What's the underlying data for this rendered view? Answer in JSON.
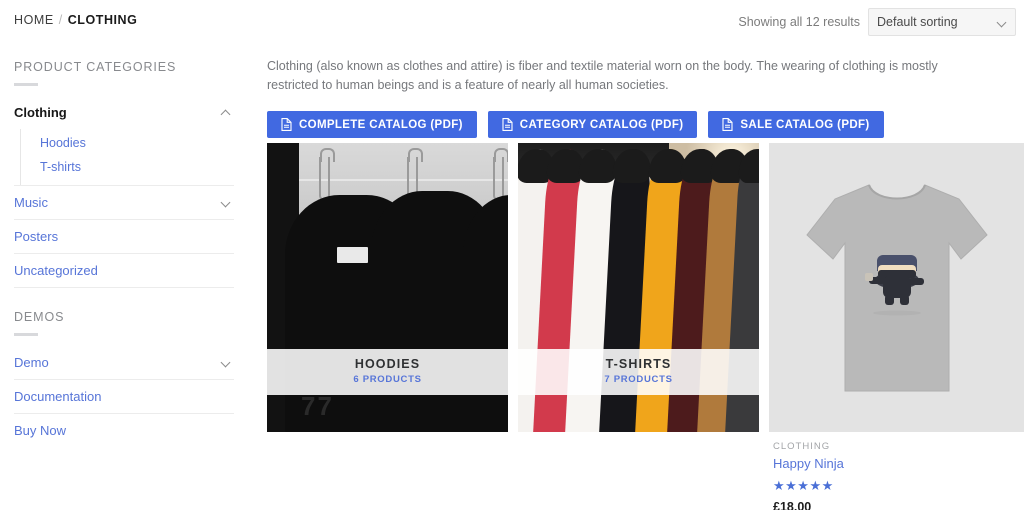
{
  "breadcrumb": {
    "home": "HOME",
    "separator": "/",
    "current": "CLOTHING"
  },
  "toolbar": {
    "result_count": "Showing all 12 results",
    "sort_selected": "Default sorting",
    "sort_icon": "chevron-down-icon"
  },
  "sidebar": {
    "categories_heading": "PRODUCT CATEGORIES",
    "categories": [
      {
        "label": "Clothing",
        "active": true,
        "toggle": "chevron-up-icon",
        "children": [
          {
            "label": "Hoodies"
          },
          {
            "label": "T-shirts"
          }
        ]
      },
      {
        "label": "Music",
        "active": false,
        "toggle": "chevron-down-icon"
      },
      {
        "label": "Posters",
        "active": false,
        "toggle": ""
      },
      {
        "label": "Uncategorized",
        "active": false,
        "toggle": ""
      }
    ],
    "demos_heading": "DEMOS",
    "demos": [
      {
        "label": "Demo",
        "toggle": "chevron-down-icon"
      },
      {
        "label": "Documentation",
        "toggle": ""
      },
      {
        "label": "Buy Now",
        "toggle": ""
      }
    ]
  },
  "main": {
    "description": "Clothing (also known as clothes and attire) is fiber and textile material worn on the body. The wearing of clothing is mostly restricted to human beings and is a feature of nearly all human societies.",
    "buttons": [
      {
        "label": "COMPLETE CATALOG (PDF)",
        "icon": "pdf-file-icon",
        "color": "#4169e1"
      },
      {
        "label": "CATEGORY CATALOG (PDF)",
        "icon": "pdf-file-icon",
        "color": "#4169e1"
      },
      {
        "label": "SALE CATALOG (PDF)",
        "icon": "pdf-file-icon",
        "color": "#4169e1"
      }
    ],
    "category_cards": [
      {
        "title": "HOODIES",
        "count": "6 PRODUCTS"
      },
      {
        "title": "T-SHIRTS",
        "count": "7 PRODUCTS"
      }
    ],
    "product": {
      "category": "CLOTHING",
      "title": "Happy Ninja",
      "rating_stars": "★★★★★",
      "price": "£18.00"
    }
  },
  "colors": {
    "accent_blue": "#4169e1",
    "link_blue": "#5775d8",
    "heading_gray": "#888a8e"
  }
}
